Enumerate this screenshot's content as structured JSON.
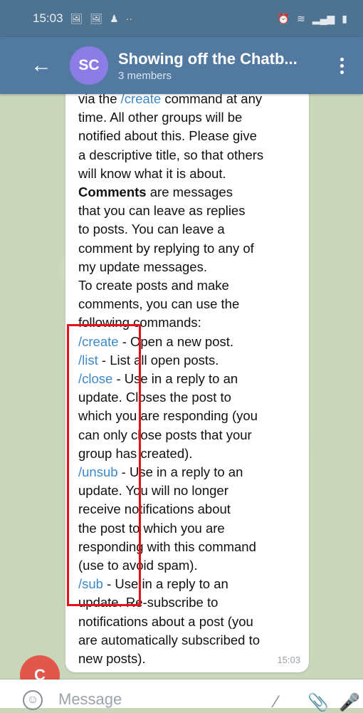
{
  "status_bar": {
    "time": "15:03",
    "icons_left": [
      "gallery-icon",
      "gallery-icon",
      "android-icon",
      "dots-icon"
    ],
    "icons_right": [
      "alarm-icon",
      "wifi-icon",
      "lte-icon",
      "signal-icon",
      "signal-icon",
      "battery-icon"
    ]
  },
  "header": {
    "avatar_initials": "SC",
    "title": "Showing off the Chatb...",
    "subtitle": "3 members",
    "avatar_color": "#8c7ce6",
    "bar_color": "#527aa0"
  },
  "message": {
    "lines": [
      [
        {
          "t": "via the "
        },
        {
          "t": "/create",
          "c": "cmd"
        },
        {
          "t": " command at any"
        }
      ],
      [
        {
          "t": "time. All other groups will be"
        }
      ],
      [
        {
          "t": "notified about this. Please give"
        }
      ],
      [
        {
          "t": "a descriptive title, so that others"
        }
      ],
      [
        {
          "t": "will know what it is about."
        }
      ],
      [
        {
          "t": "Comments",
          "c": "bold"
        },
        {
          "t": " are messages"
        }
      ],
      [
        {
          "t": "that you can leave as replies"
        }
      ],
      [
        {
          "t": "to posts. You can leave a"
        }
      ],
      [
        {
          "t": "comment by replying to any of"
        }
      ],
      [
        {
          "t": "my update messages."
        }
      ],
      [
        {
          "t": "To create posts and make"
        }
      ],
      [
        {
          "t": "comments, you can use the"
        }
      ],
      [
        {
          "t": "following commands:"
        }
      ],
      [
        {
          "t": "/create",
          "c": "cmd"
        },
        {
          "t": " - Open a new post."
        }
      ],
      [
        {
          "t": "/list",
          "c": "cmd"
        },
        {
          "t": " - List all open posts."
        }
      ],
      [
        {
          "t": "/close",
          "c": "cmd"
        },
        {
          "t": " - Use in a reply to an"
        }
      ],
      [
        {
          "t": "update. Closes the post to"
        }
      ],
      [
        {
          "t": "which you are responding (you"
        }
      ],
      [
        {
          "t": "can only close posts that your"
        }
      ],
      [
        {
          "t": "group has created)."
        }
      ],
      [
        {
          "t": "/unsub",
          "c": "cmd"
        },
        {
          "t": " - Use in a reply to an"
        }
      ],
      [
        {
          "t": "update. You will no longer"
        }
      ],
      [
        {
          "t": "receive notifications about"
        }
      ],
      [
        {
          "t": "the post to which you are"
        }
      ],
      [
        {
          "t": "responding with this command"
        }
      ],
      [
        {
          "t": "(use to avoid spam)."
        }
      ],
      [
        {
          "t": "/sub",
          "c": "cmd"
        },
        {
          "t": " - Use in a reply to an"
        }
      ],
      [
        {
          "t": "update. Re-subscribe to"
        }
      ],
      [
        {
          "t": "notifications about a post (you"
        }
      ],
      [
        {
          "t": "are automatically subscribed to"
        }
      ],
      [
        {
          "t": "new posts)."
        }
      ]
    ],
    "time": "15:03",
    "sender_initial": "C",
    "sender_color": "#e2574c"
  },
  "input": {
    "placeholder": "Message"
  },
  "colors": {
    "command": "#3d88c7",
    "highlight_box": "#e4121a"
  }
}
